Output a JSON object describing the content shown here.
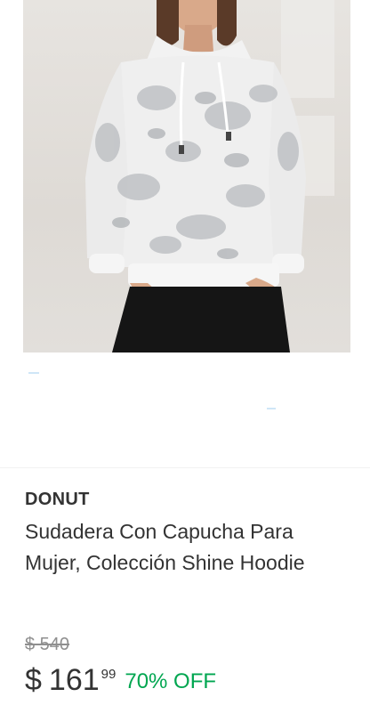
{
  "product": {
    "image_alt": "Sudadera con capucha blanca con estampado plateado",
    "brand": "DONUT",
    "title": "Sudadera Con Capucha Para Mujer, Colección Shine Hoodie",
    "original_price": "$ 540",
    "price": {
      "currency": "$",
      "amount": "161",
      "cents": "99"
    },
    "discount": "70% OFF"
  },
  "colors": {
    "discount": "#00a650",
    "text": "#333333",
    "muted": "#8f8f8f"
  }
}
